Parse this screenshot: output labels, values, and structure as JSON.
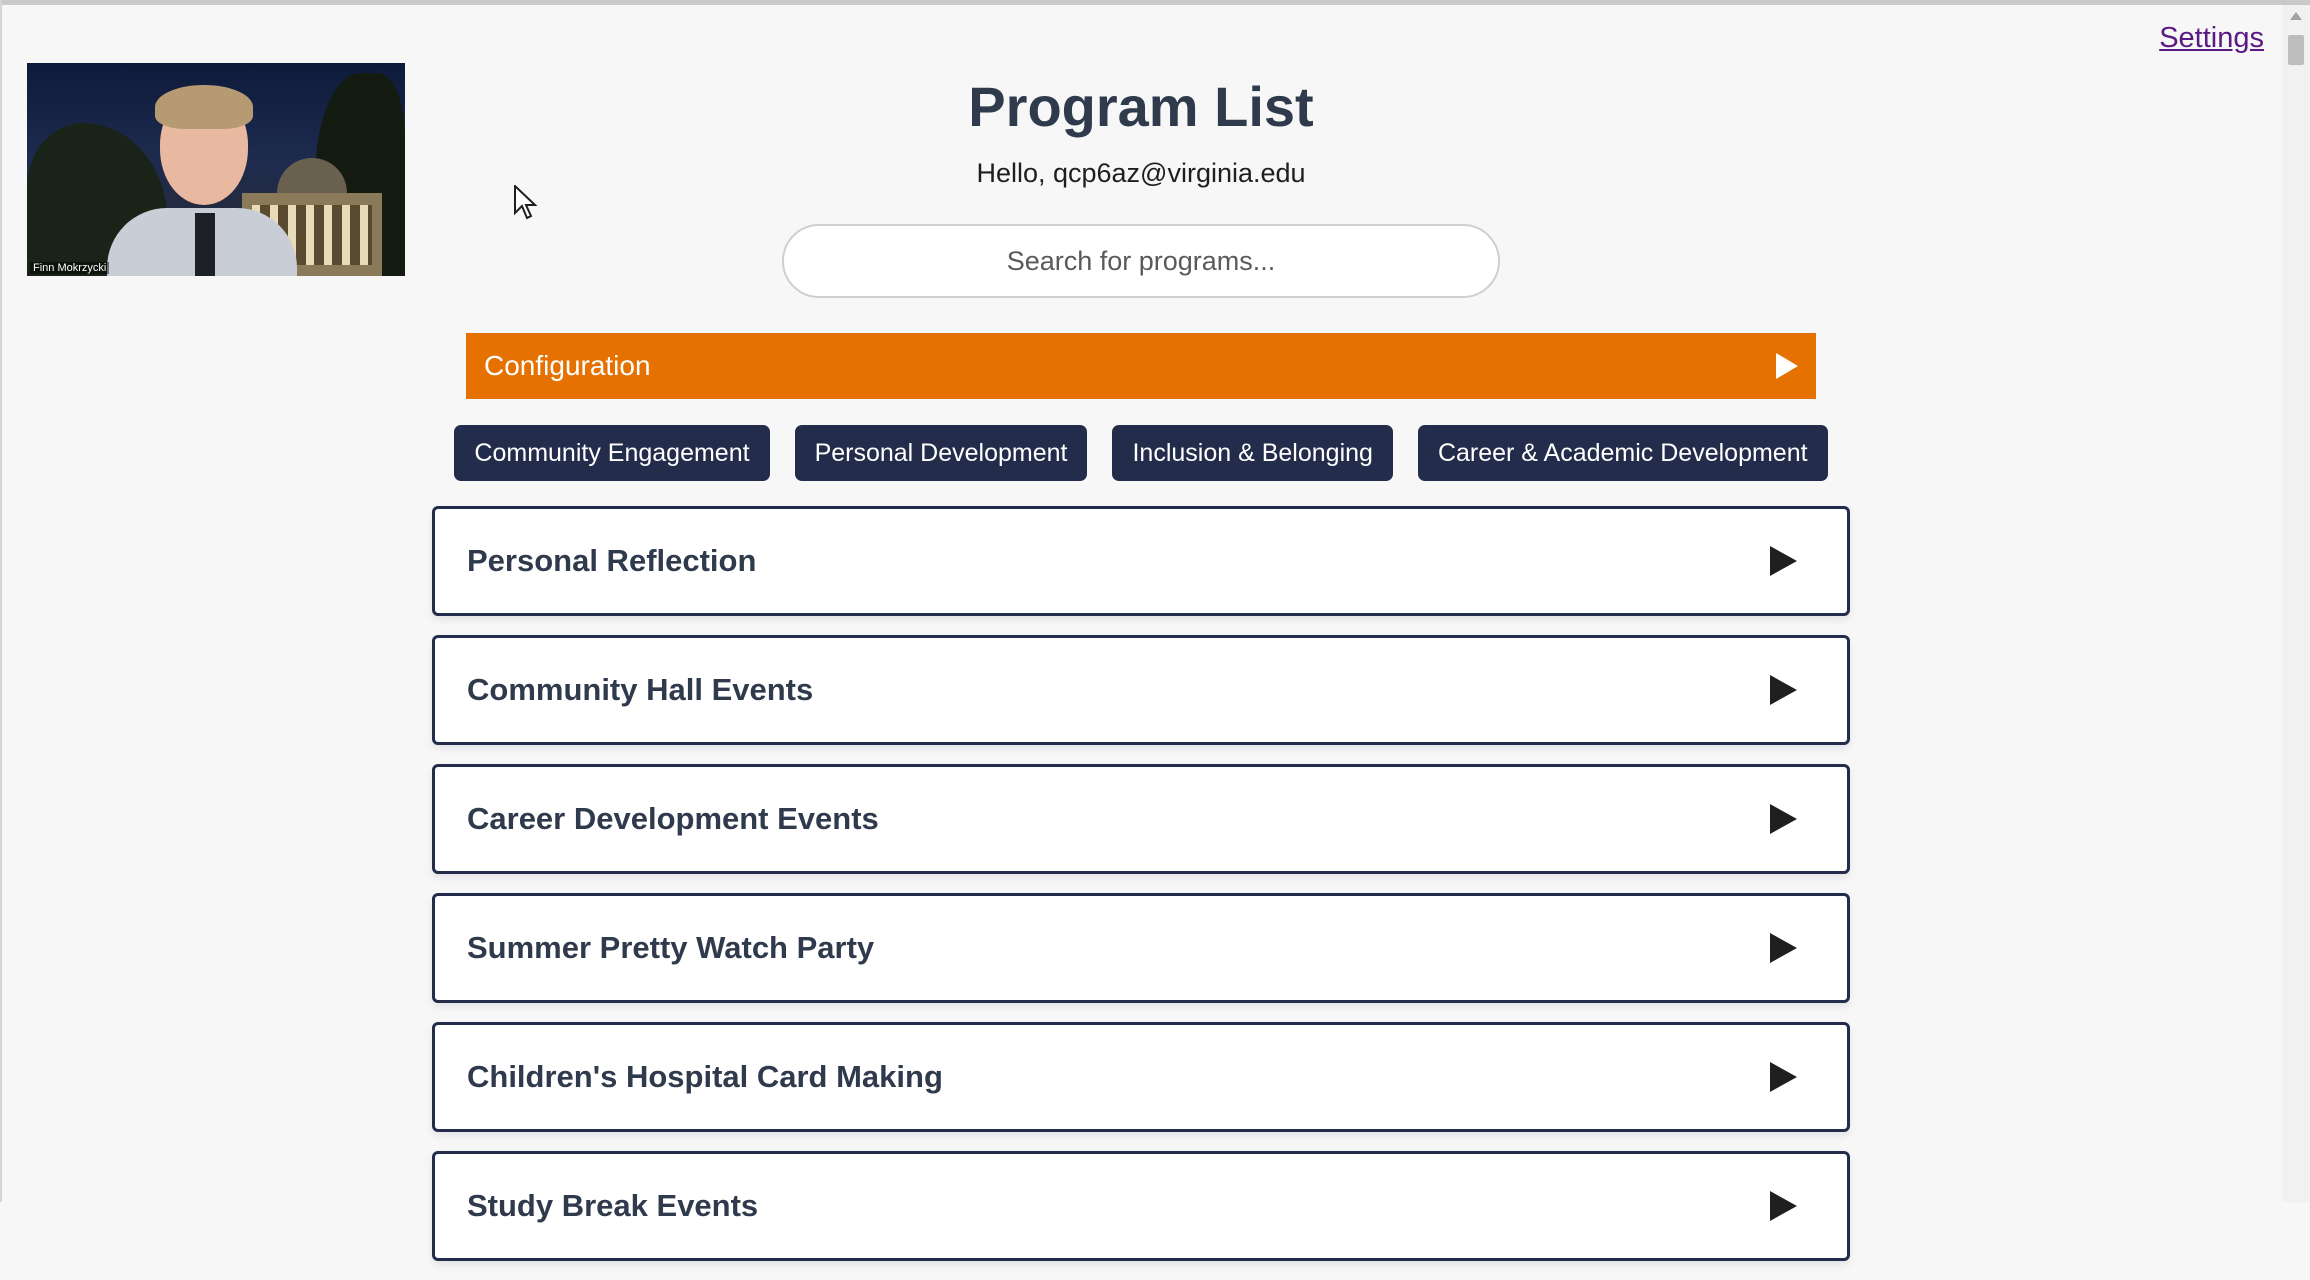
{
  "header": {
    "title": "Program List",
    "greeting": "Hello, qcp6az@virginia.edu",
    "settings_label": "Settings"
  },
  "video_call": {
    "participant_name": "Finn Mokrzycki"
  },
  "search": {
    "placeholder": "Search for programs...",
    "value": ""
  },
  "configuration": {
    "label": "Configuration",
    "color": "#e57200"
  },
  "categories": [
    {
      "label": "Community Engagement"
    },
    {
      "label": "Personal Development"
    },
    {
      "label": "Inclusion & Belonging"
    },
    {
      "label": "Career & Academic Development"
    }
  ],
  "programs": [
    {
      "name": "Personal Reflection"
    },
    {
      "name": "Community Hall Events"
    },
    {
      "name": "Career Development Events"
    },
    {
      "name": "Summer Pretty Watch Party"
    },
    {
      "name": "Children's Hospital Card Making"
    },
    {
      "name": "Study Break Events"
    }
  ],
  "colors": {
    "navy": "#232d4b",
    "orange": "#e57200",
    "link": "#5b1a82"
  },
  "icons": {
    "expand": "play-triangle-icon",
    "pointer": "mouse-cursor-icon"
  }
}
